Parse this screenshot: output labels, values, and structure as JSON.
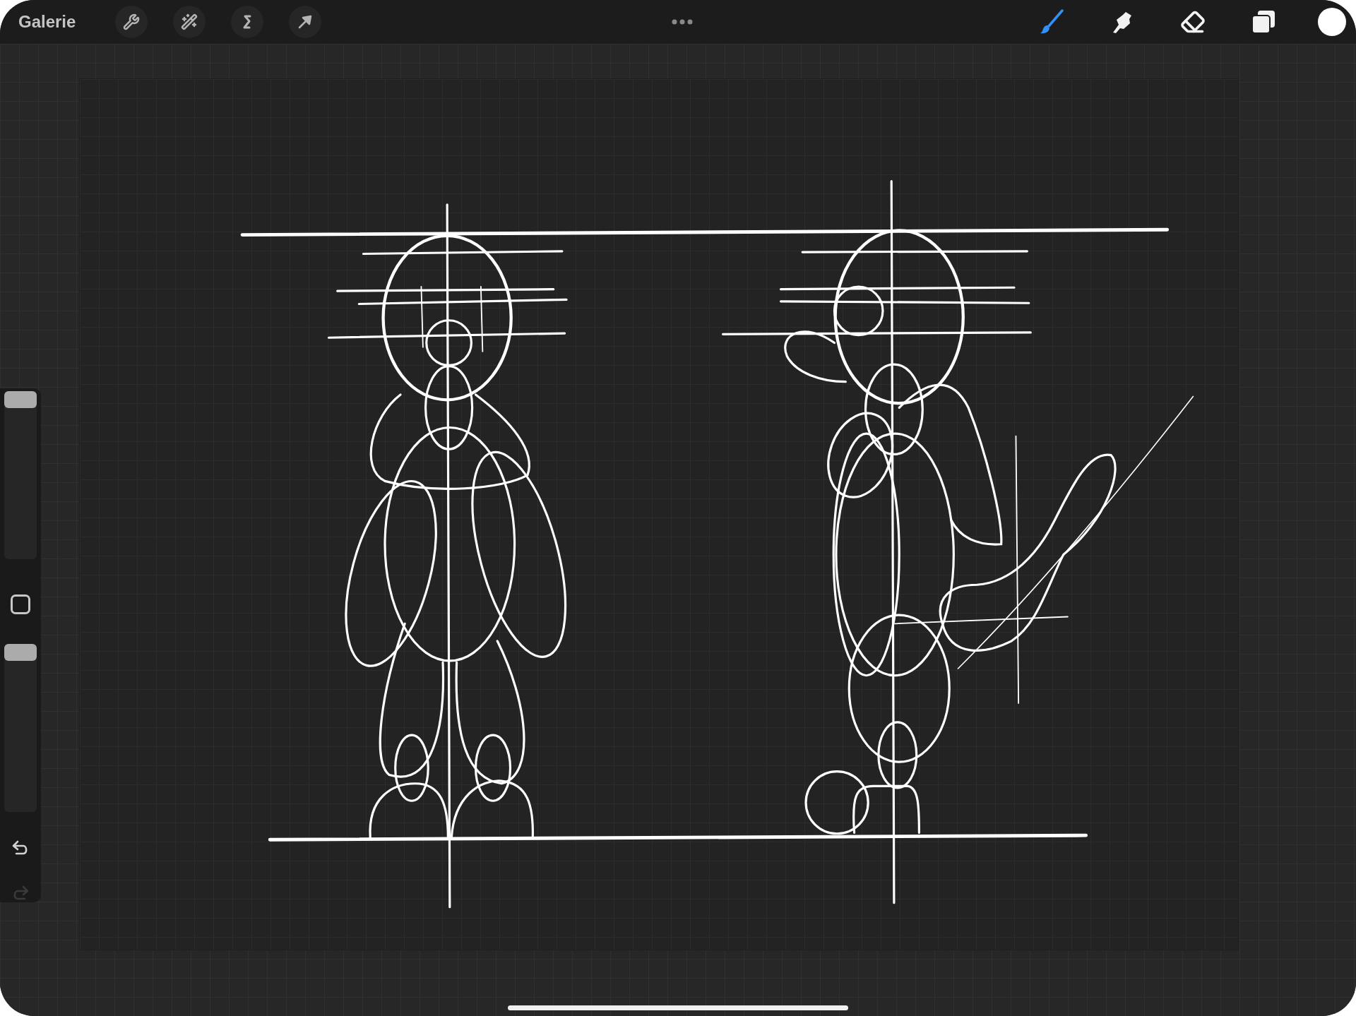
{
  "top_bar": {
    "gallery": "Galerie",
    "actions": [
      {
        "kind": "settings"
      },
      {
        "kind": "adjust"
      },
      {
        "kind": "select"
      },
      {
        "kind": "transform"
      }
    ],
    "tools": [
      {
        "kind": "brush",
        "selected": true
      },
      {
        "kind": "smudge",
        "selected": false
      },
      {
        "kind": "eraser",
        "selected": false
      },
      {
        "kind": "layers",
        "selected": false
      }
    ]
  },
  "sidebar": {
    "sliders": [
      {
        "level": 1
      },
      {
        "level": 1
      }
    ],
    "undo": {
      "disabled": false
    },
    "redo": {
      "disabled": true
    }
  }
}
